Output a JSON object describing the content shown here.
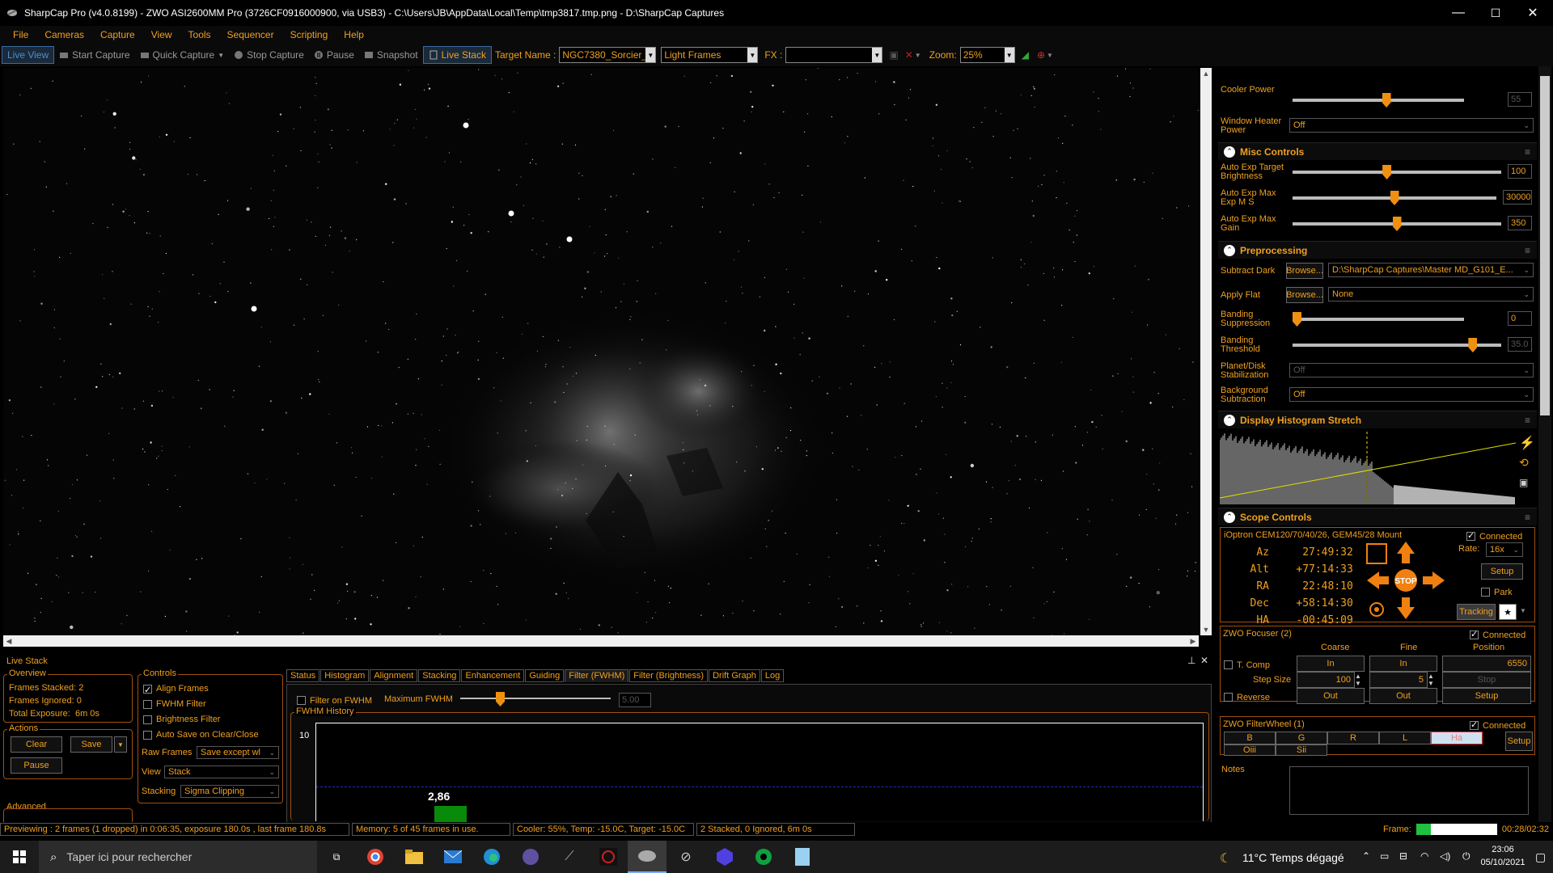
{
  "window": {
    "title": "SharpCap Pro (v4.0.8199) - ZWO ASI2600MM Pro (3726CF0916000900, via USB3) - C:\\Users\\JB\\AppData\\Local\\Temp\\tmp3817.tmp.png - D:\\SharpCap Captures",
    "minimize": "—",
    "maximize": "☐",
    "close": "✕"
  },
  "menu": [
    "File",
    "Cameras",
    "Capture",
    "View",
    "Tools",
    "Sequencer",
    "Scripting",
    "Help"
  ],
  "toolbar": {
    "live_view": "Live View",
    "start_capture": "Start Capture",
    "quick_capture": "Quick Capture",
    "stop_capture": "Stop Capture",
    "pause": "Pause",
    "snapshot": "Snapshot",
    "live_stack": "Live Stack",
    "target_label": "Target Name :",
    "target_value": "NGC7380_Sorcier_l",
    "frame_type": "Light Frames",
    "fx_label": "FX :",
    "fx_value": "",
    "zoom_label": "Zoom:",
    "zoom_value": "25%"
  },
  "right_panel": {
    "cooler_power": {
      "label": "Cooler Power",
      "value": "55",
      "fraction": 0.55
    },
    "window_heater": {
      "label": "Window Heater Power",
      "value": "Off"
    },
    "misc_controls": {
      "title": "Misc Controls",
      "auto_exp_target": {
        "label": "Auto Exp Target Brightness",
        "value": "100",
        "fraction": 0.45
      },
      "auto_exp_max_exp": {
        "label": "Auto Exp Max Exp M S",
        "value": "30000",
        "fraction": 0.5
      },
      "auto_exp_max_gain": {
        "label": "Auto Exp Max Gain",
        "value": "350",
        "fraction": 0.5
      }
    },
    "preprocessing": {
      "title": "Preprocessing",
      "subtract_dark": {
        "label": "Subtract Dark",
        "browse": "Browse...",
        "value": "D:\\SharpCap Captures\\Master MD_G101_E..."
      },
      "apply_flat": {
        "label": "Apply Flat",
        "browse": "Browse...",
        "value": "None"
      },
      "banding_suppression": {
        "label": "Banding Suppression",
        "value": "0",
        "fraction": 0.0
      },
      "banding_threshold": {
        "label": "Banding Threshold",
        "value": "35.0",
        "fraction": 0.88
      },
      "planet_disk": {
        "label": "Planet/Disk Stabilization",
        "value": "Off"
      },
      "background_sub": {
        "label": "Background Subtraction",
        "value": "Off"
      }
    },
    "histogram": {
      "title": "Display Histogram Stretch"
    },
    "scope": {
      "title": "Scope Controls",
      "mount": "iOptron CEM120/70/40/26, GEM45/28 Mount",
      "connected": "Connected",
      "az_label": "Az",
      "az": "27:49:32",
      "alt_label": "Alt",
      "alt": "+77:14:33",
      "ra_label": "RA",
      "ra": "22:48:10",
      "dec_label": "Dec",
      "dec": "+58:14:30",
      "ha_label": "HA",
      "ha": "-00:45:09",
      "rate_label": "Rate:",
      "rate": "16x",
      "setup": "Setup",
      "park": "Park",
      "tracking": "Tracking",
      "stop": "STOP"
    },
    "focuser": {
      "title": "ZWO Focuser (2)",
      "connected": "Connected",
      "coarse": "Coarse",
      "fine": "Fine",
      "position": "Position",
      "t_comp": "T. Comp",
      "in_label": "In",
      "position_value": "6550",
      "step_size": "Step Size",
      "coarse_step": "100",
      "fine_step": "5",
      "stop": "Stop",
      "reverse": "Reverse",
      "out_label": "Out",
      "setup": "Setup"
    },
    "filterwheel": {
      "title": "ZWO FilterWheel (1)",
      "connected": "Connected",
      "filters_row1": [
        "B",
        "G",
        "R",
        "L",
        "Ha"
      ],
      "filters_row2": [
        "Oiii",
        "Sii"
      ],
      "selected": "Ha",
      "setup": "Setup"
    },
    "notes": {
      "label": "Notes"
    },
    "frame": {
      "label": "Frame:",
      "value": "00:28/02:32",
      "progress": 0.18
    }
  },
  "live_stack": {
    "title": "Live Stack",
    "overview": {
      "title": "Overview",
      "frames_stacked_label": "Frames Stacked:",
      "frames_stacked": "2",
      "frames_ignored_label": "Frames Ignored:",
      "frames_ignored": "0",
      "total_exposure_label": "Total Exposure:",
      "total_exposure": "6m 0s"
    },
    "actions": {
      "title": "Actions",
      "clear": "Clear",
      "save": "Save",
      "pause": "Pause"
    },
    "advanced": {
      "title": "Advanced"
    },
    "controls": {
      "title": "Controls",
      "align_frames": "Align Frames",
      "fwhm_filter": "FWHM Filter",
      "brightness_filter": "Brightness Filter",
      "auto_save": "Auto Save on Clear/Close",
      "raw_frames_label": "Raw Frames",
      "raw_frames": "Save except wl",
      "view_label": "View",
      "view": "Stack",
      "stacking_label": "Stacking",
      "stacking": "Sigma Clipping"
    },
    "tabs": [
      "Status",
      "Histogram",
      "Alignment",
      "Stacking",
      "Enhancement",
      "Guiding",
      "Filter (FWHM)",
      "Filter (Brightness)",
      "Drift Graph",
      "Log"
    ],
    "active_tab": "Filter (FWHM)",
    "filter_on_fwhm": "Filter on FWHM",
    "max_fwhm_label": "Maximum FWHM",
    "max_fwhm_value": "5.00",
    "fwhm_history_title": "FWHM History",
    "y_tick": "10",
    "bar_label": "2,86"
  },
  "status": {
    "previewing": "Previewing : 2 frames (1 dropped) in 0:06:35, exposure 180.0s , last frame 180.8s",
    "memory": "Memory: 5 of 45 frames in use.",
    "cooler": "Cooler: 55%, Temp: -15.0C, Target: -15.0C",
    "stacked": "2 Stacked, 0 Ignored, 6m 0s"
  },
  "taskbar": {
    "search_placeholder": "Taper ici pour rechercher",
    "weather": "11°C  Temps dégagé",
    "time": "23:06",
    "date": "05/10/2021"
  },
  "colors": {
    "accent": "#f0a020",
    "background": "#000000",
    "connected": "#ffffff",
    "bar": "#0a8a0a"
  }
}
